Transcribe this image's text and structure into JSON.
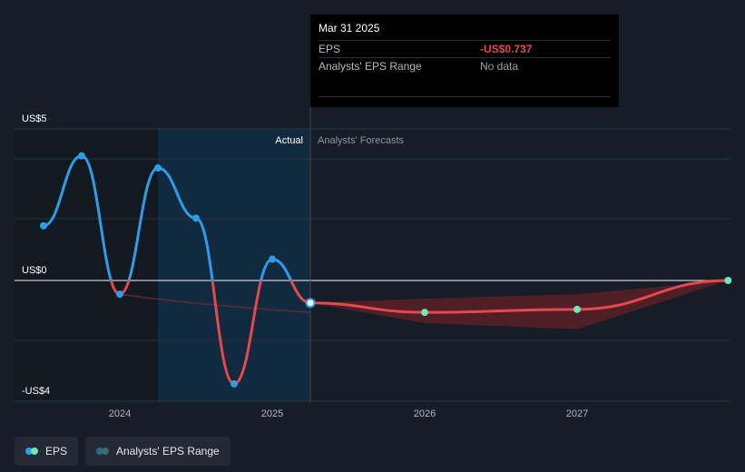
{
  "chart_data": {
    "type": "line",
    "y_tick_labels": [
      "US$5",
      "US$0",
      "-US$4"
    ],
    "x_tick_labels": [
      "2024",
      "2025",
      "2026",
      "2027"
    ],
    "ylim": [
      -4,
      5
    ],
    "section_labels": {
      "actual": "Actual",
      "forecast": "Analysts' Forecasts"
    },
    "series": [
      {
        "name": "EPS",
        "points": [
          {
            "x": 2023.5,
            "y": 1.8
          },
          {
            "x": 2023.75,
            "y": 4.1
          },
          {
            "x": 2024.0,
            "y": -0.45
          },
          {
            "x": 2024.25,
            "y": 3.7
          },
          {
            "x": 2024.5,
            "y": 2.05
          },
          {
            "x": 2024.75,
            "y": -3.4
          },
          {
            "x": 2025.0,
            "y": 0.7
          },
          {
            "x": 2025.25,
            "y": -0.737
          },
          {
            "x": 2026.0,
            "y": -1.05
          },
          {
            "x": 2027.0,
            "y": -0.95
          },
          {
            "x": 2027.99,
            "y": 0.0
          }
        ]
      },
      {
        "name": "Analysts' EPS Range",
        "upper": [
          {
            "x": 2025.25,
            "y": -0.737
          },
          {
            "x": 2026.0,
            "y": -0.6
          },
          {
            "x": 2027.0,
            "y": -0.45
          },
          {
            "x": 2027.99,
            "y": 0.0
          }
        ],
        "lower": [
          {
            "x": 2025.25,
            "y": -0.737
          },
          {
            "x": 2026.0,
            "y": -1.4
          },
          {
            "x": 2027.0,
            "y": -1.6
          },
          {
            "x": 2027.99,
            "y": 0.0
          }
        ]
      }
    ],
    "reference_curve": [
      {
        "x": 2024.0,
        "y": -0.45
      },
      {
        "x": 2024.5,
        "y": -0.8
      },
      {
        "x": 2025.25,
        "y": -1.05
      }
    ],
    "highlight": {
      "x_start": 2024.25,
      "x_end": 2025.25
    },
    "colors": {
      "positive": "#2e9de8",
      "negative": "#e5484d",
      "forecast_marker": "#6ee7b7",
      "range_fill": "#5a1e26",
      "highlight": "#112a40",
      "background": "#161d27"
    }
  },
  "tooltip": {
    "date": "Mar 31 2025",
    "rows": [
      {
        "label": "EPS",
        "value": "-US$0.737"
      },
      {
        "label": "Analysts' EPS Range",
        "value": "No data"
      }
    ]
  },
  "legend": [
    {
      "label": "EPS",
      "icon": "eps-dot-icon"
    },
    {
      "label": "Analysts' EPS Range",
      "icon": "range-dot-icon"
    }
  ]
}
